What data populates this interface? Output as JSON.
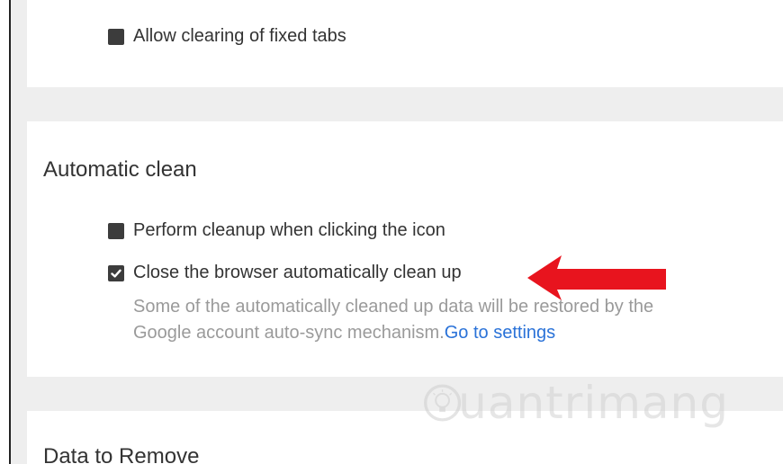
{
  "settings": {
    "fixed_tabs_option": {
      "label": "Allow clearing of fixed tabs",
      "checked": false
    },
    "automatic_clean": {
      "title": "Automatic clean",
      "options": [
        {
          "label": "Perform cleanup when clicking the icon",
          "checked": false
        },
        {
          "label": "Close the browser automatically clean up",
          "checked": true
        }
      ],
      "description": "Some of the automatically cleaned up data will be restored by the Google account auto-sync mechanism.",
      "link_text": "Go to settings"
    },
    "data_to_remove": {
      "title": "Data to Remove"
    }
  },
  "colors": {
    "page_background": "#eeeeee",
    "card_background": "#ffffff",
    "checkbox": "#3c3c3c",
    "link": "#2a72d8",
    "annotation_arrow": "#e8141e",
    "muted_text": "#9a9a9a"
  },
  "watermark": {
    "text": "uantrimang",
    "icon": "lightbulb-icon"
  }
}
